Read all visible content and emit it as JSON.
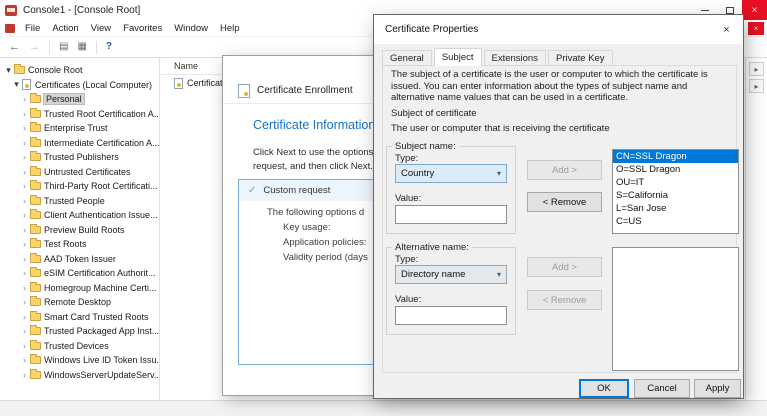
{
  "icons": {
    "close": "×",
    "back": "←",
    "forward": "→",
    "help": "?",
    "check": "✓",
    "combo_arrow": "▾",
    "console_tree": "▤",
    "export_list": "▦",
    "actions_arrow": "▸"
  },
  "mmc": {
    "title": "Console1 - [Console Root]",
    "menu": [
      "File",
      "Action",
      "View",
      "Favorites",
      "Window",
      "Help"
    ],
    "tree": {
      "root_label": "Console Root",
      "store_label": "Certificates (Local Computer)",
      "items": [
        {
          "label": "Personal",
          "selected": true
        },
        {
          "label": "Trusted Root Certification A..."
        },
        {
          "label": "Enterprise Trust"
        },
        {
          "label": "Intermediate Certification A..."
        },
        {
          "label": "Trusted Publishers"
        },
        {
          "label": "Untrusted Certificates"
        },
        {
          "label": "Third-Party Root Certificati..."
        },
        {
          "label": "Trusted People"
        },
        {
          "label": "Client Authentication Issue..."
        },
        {
          "label": "Preview Build Roots"
        },
        {
          "label": "Test Roots"
        },
        {
          "label": "AAD Token Issuer"
        },
        {
          "label": "eSIM Certification Authorit..."
        },
        {
          "label": "Homegroup Machine Certi..."
        },
        {
          "label": "Remote Desktop"
        },
        {
          "label": "Smart Card Trusted Roots"
        },
        {
          "label": "Trusted Packaged App Inst..."
        },
        {
          "label": "Trusted Devices"
        },
        {
          "label": "Windows Live ID Token Issu..."
        },
        {
          "label": "WindowsServerUpdateServ..."
        }
      ]
    },
    "list_pane": {
      "column_header": "Name",
      "item": "Certificates"
    }
  },
  "enrollment": {
    "header_title": "Certificate Enrollment",
    "heading": "Certificate Information",
    "intro_line1": "Click Next to use the options",
    "intro_line2": "request, and then click Next.",
    "custom_request_label": "Custom request",
    "detail_intro": "The following options d",
    "detail_rows": [
      "Key usage:",
      "Application policies:",
      "Validity period (days"
    ]
  },
  "props": {
    "title": "Certificate Properties",
    "tabs": [
      {
        "label": "General"
      },
      {
        "label": "Subject",
        "selected": true
      },
      {
        "label": "Extensions"
      },
      {
        "label": "Private Key"
      }
    ],
    "description": "The subject of a certificate is the user or computer to which the certificate is issued. You can enter information about the types of subject name and alternative name values that can be used in a certificate.",
    "subject_heading": "Subject of certificate",
    "subject_subheading": "The user or computer that is receiving the certificate",
    "subject_group": {
      "label": "Subject name:",
      "type_label": "Type:",
      "type_value": "Country",
      "value_label": "Value:",
      "value_text": "",
      "add": "Add >",
      "remove": "< Remove",
      "entries": [
        {
          "label": "CN=SSL Dragon",
          "selected": true
        },
        {
          "label": "O=SSL Dragon"
        },
        {
          "label": "OU=IT"
        },
        {
          "label": "S=California"
        },
        {
          "label": "L=San Jose"
        },
        {
          "label": "C=US"
        }
      ]
    },
    "alt_group": {
      "label": "Alternative name:",
      "type_label": "Type:",
      "type_value": "Directory name",
      "value_label": "Value:",
      "value_text": "",
      "add": "Add >",
      "remove": "< Remove",
      "entries": []
    },
    "buttons": {
      "ok": "OK",
      "cancel": "Cancel",
      "apply": "Apply"
    },
    "accent_color": "#0078d7"
  }
}
